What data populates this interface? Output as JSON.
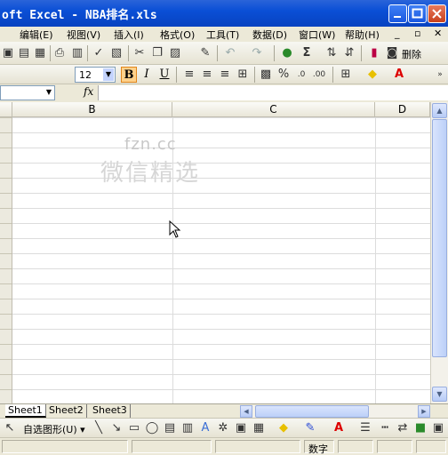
{
  "window": {
    "title": "oft Excel - NBA排名.xls"
  },
  "menu": {
    "items": [
      "编辑(E)",
      "视图(V)",
      "插入(I)",
      "格式(O)",
      "工具(T)",
      "数据(D)",
      "窗口(W)",
      "帮助(H)"
    ]
  },
  "toolbar": {
    "font_size": "12",
    "bold_label": "B",
    "italic_label": "I",
    "underline_label": "U",
    "sigma_label": "Σ",
    "percent_label": "%",
    "delete_label": "删除"
  },
  "formula_bar": {
    "fx_label": "fx"
  },
  "grid": {
    "columns": [
      "B",
      "C",
      "D"
    ]
  },
  "watermark": {
    "line1": "fzn.cc",
    "line2": "微信精选"
  },
  "sheets": [
    "Sheet1",
    "Sheet2",
    "Sheet3"
  ],
  "drawing_toolbar": {
    "autoshapes_label": "自选图形(U) ▾"
  },
  "status": {
    "mode": "数字"
  }
}
